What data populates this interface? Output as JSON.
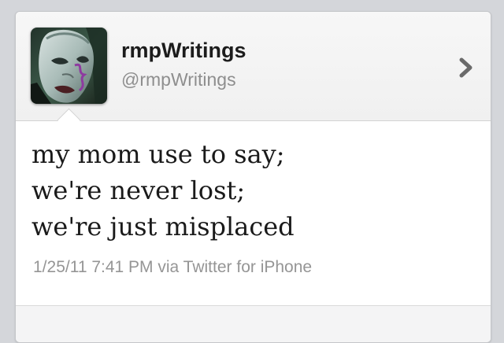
{
  "profile": {
    "display_name": "rmpWritings",
    "username": "@rmpWritings",
    "avatar_icon": "masked-face-avatar",
    "open_profile_icon": "chevron-right-icon"
  },
  "tweet": {
    "text": "my mom use to say;\nwe're never lost;\nwe're just misplaced",
    "timestamp": "1/25/11 7:41 PM",
    "source": "via Twitter for iPhone",
    "meta_line": "1/25/11 7:41 PM via Twitter for iPhone"
  },
  "colors": {
    "background": "#d4d6da",
    "card": "#ffffff",
    "header": "#f2f2f2",
    "name_text": "#1c1c1c",
    "secondary_text": "#8e8e8e"
  }
}
